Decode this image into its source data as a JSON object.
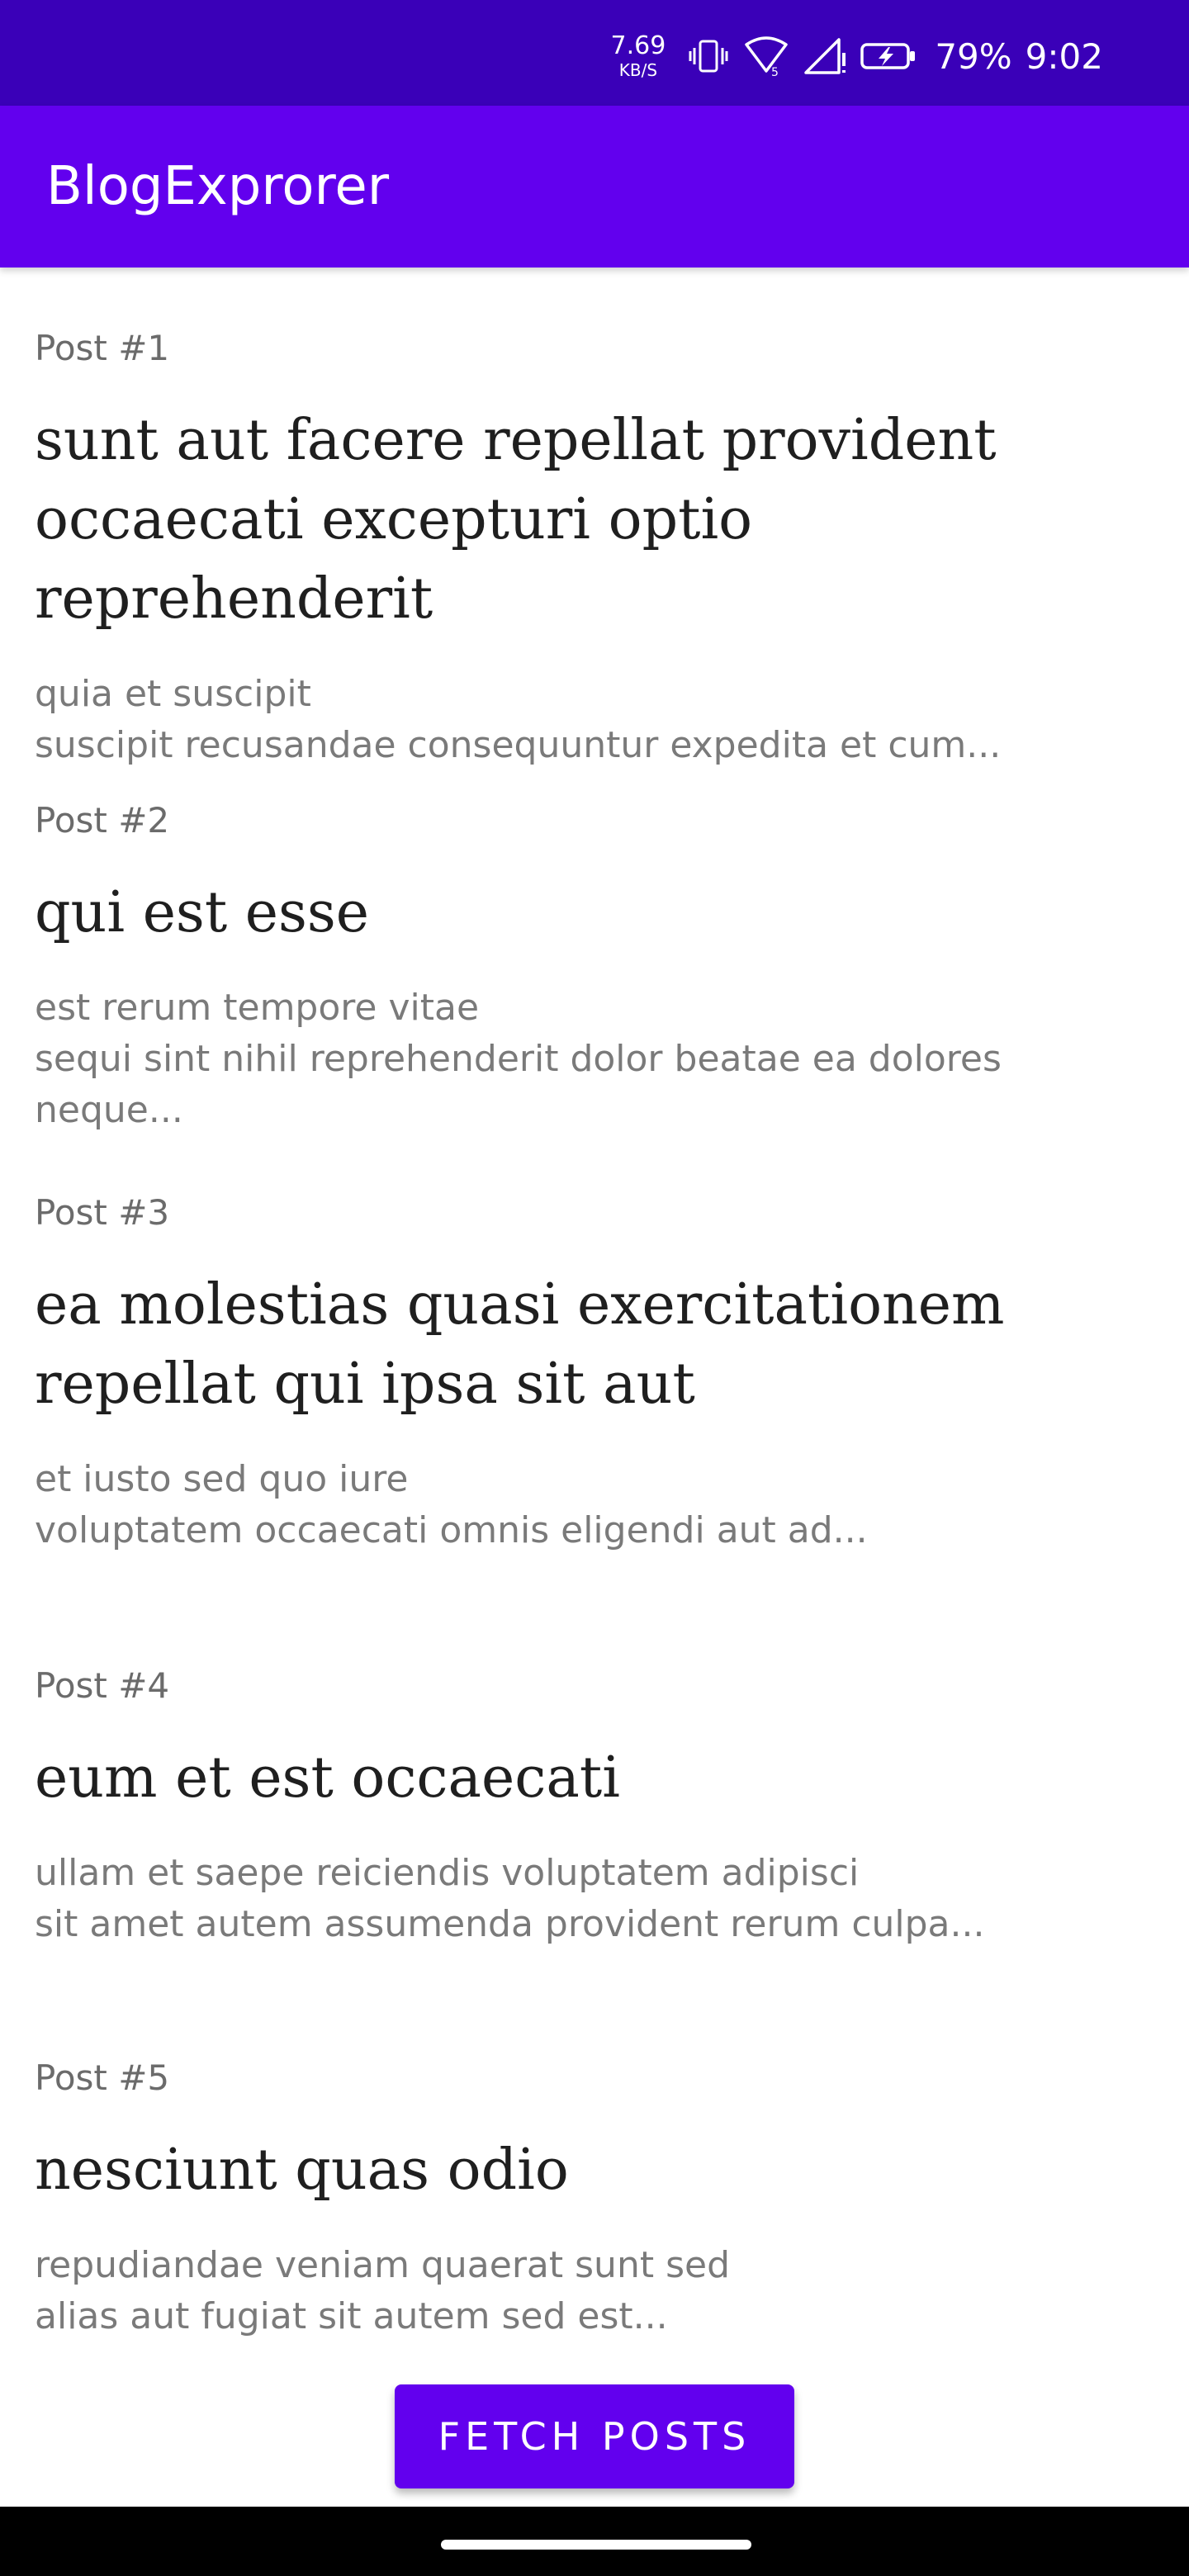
{
  "status_bar": {
    "net_speed": "7.69",
    "net_unit": "KB/S",
    "battery_percent": "79%",
    "time": "9:02",
    "icons": [
      "vibrate-icon",
      "wifi-icon",
      "signal-icon",
      "battery-charging-icon"
    ]
  },
  "app_bar": {
    "title": "BlogExprorer"
  },
  "posts": [
    {
      "number": "Post #1",
      "title": "sunt aut facere repellat provident occaecati excepturi optio reprehenderit",
      "body": "quia et suscipit\nsuscipit recusandae consequuntur expedita et cum..."
    },
    {
      "number": "Post #2",
      "title": "qui est esse",
      "body": "est rerum tempore vitae\nsequi sint nihil reprehenderit dolor beatae ea dolores neque..."
    },
    {
      "number": "Post #3",
      "title": "ea molestias quasi exercitationem repellat qui ipsa sit aut",
      "body": "et iusto sed quo iure\nvoluptatem occaecati omnis eligendi aut ad..."
    },
    {
      "number": "Post #4",
      "title": "eum et est occaecati",
      "body": "ullam et saepe reiciendis voluptatem adipisci\nsit amet autem assumenda provident rerum culpa..."
    },
    {
      "number": "Post #5",
      "title": "nesciunt quas odio",
      "body": "repudiandae veniam quaerat sunt sed\nalias aut fugiat sit autem sed est..."
    }
  ],
  "fetch_button": {
    "label": "FETCH POSTS"
  },
  "colors": {
    "status_bar": "#3a00b8",
    "app_bar": "#6200ee",
    "button": "#6200ee",
    "nav_bar": "#000000"
  }
}
